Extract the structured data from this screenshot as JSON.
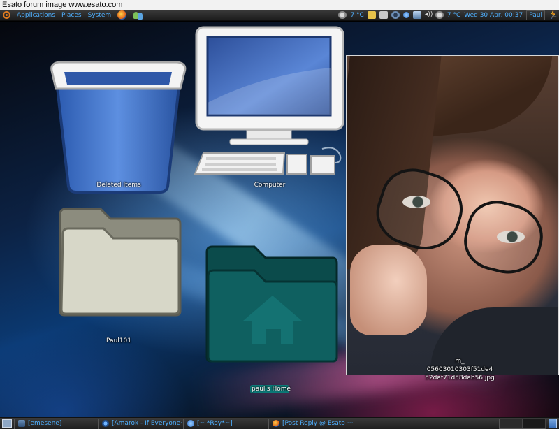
{
  "watermark": "Esato forum image www.esato.com",
  "top_panel": {
    "menu": [
      "Applications",
      "Places",
      "System"
    ],
    "weather1": "7 °C",
    "weather2": "7 °C",
    "clock": "Wed 30 Apr, 00:37",
    "user": "Paul",
    "icons": [
      "ubuntu-logo-icon",
      "firefox-icon",
      "people-icon",
      "weather-icon",
      "mail-icon",
      "clipboard-icon",
      "sync-icon",
      "status-icon",
      "network-icon",
      "volume-icon",
      "run-icon"
    ]
  },
  "desktop": {
    "icons": [
      {
        "label": "Deleted Items",
        "icon": "trash-icon"
      },
      {
        "label": "Computer",
        "icon": "computer-icon"
      },
      {
        "label": "Paul101",
        "icon": "folder-icon"
      },
      {
        "label": "paul's Home",
        "icon": "home-folder-icon"
      }
    ],
    "photo": {
      "label_line1": "m_",
      "label_line2": "05603010303f51de4",
      "label_line3": "52daf71d58dab56.jpg"
    }
  },
  "bottom_panel": {
    "tasks": [
      {
        "label": "[emesene]",
        "icon": "emesene-icon"
      },
      {
        "label": "[Amarok - If Everyone⋯",
        "icon": "amarok-icon"
      },
      {
        "label": "[~ *Roy*~]",
        "icon": "chat-icon"
      },
      {
        "label": "[Post Reply @ Esato ⋯",
        "icon": "firefox-icon"
      }
    ]
  },
  "colors": {
    "panel_text": "#4fb0ff",
    "home_folder": "#0f5a5a",
    "folder_gray": "#b8b8a8",
    "trash_blue": "#3a6fc8"
  }
}
